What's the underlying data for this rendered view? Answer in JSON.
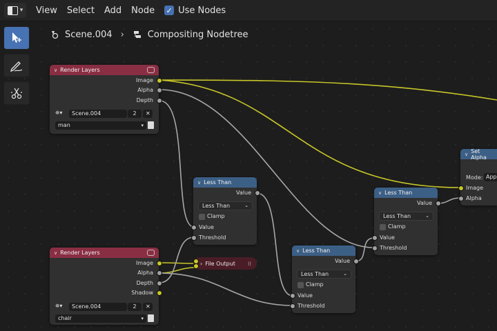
{
  "menu": {
    "view": "View",
    "select": "Select",
    "add": "Add",
    "node": "Node",
    "use_nodes": "Use Nodes"
  },
  "breadcrumb": {
    "scene": "Scene.004",
    "tree": "Compositing Nodetree"
  },
  "nodes": {
    "rl1": {
      "title": "Render Layers",
      "outputs": [
        "Image",
        "Alpha",
        "Depth"
      ],
      "scene": "Scene.004",
      "users": "2",
      "layer": "man"
    },
    "rl2": {
      "title": "Render Layers",
      "outputs": [
        "Image",
        "Alpha",
        "Depth",
        "Shadow"
      ],
      "scene": "Scene.004",
      "users": "2",
      "layer": "chair"
    },
    "lt1": {
      "title": "Less Than",
      "output": "Value",
      "op": "Less Than",
      "clamp": "Clamp",
      "in1": "Value",
      "in2": "Threshold"
    },
    "lt2": {
      "title": "Less Than",
      "output": "Value",
      "op": "Less Than",
      "clamp": "Clamp",
      "in1": "Value",
      "in2": "Threshold"
    },
    "lt3": {
      "title": "Less Than",
      "output": "Value",
      "op": "Less Than",
      "clamp": "Clamp",
      "in1": "Value",
      "in2": "Threshold"
    },
    "setalpha": {
      "title": "Set Alpha",
      "mode_label": "Mode:",
      "mode_value": "App",
      "in1": "Image",
      "in2": "Alpha"
    },
    "fileout": {
      "title": "File Output"
    }
  },
  "colors": {
    "render_header": "#8a2e43",
    "converter_header": "#3c5f86",
    "image_socket": "#c7c729",
    "value_socket": "#a1a1a1",
    "accent": "#4772b3"
  }
}
